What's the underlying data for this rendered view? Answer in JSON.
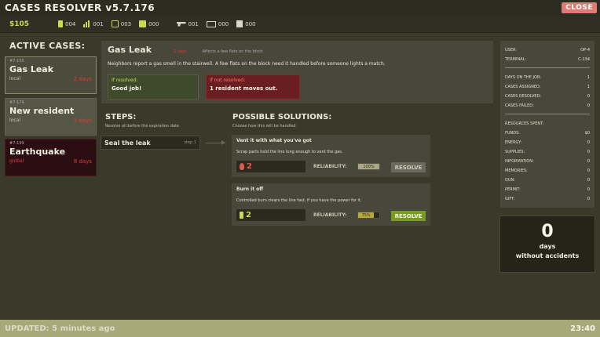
{
  "app": {
    "title": "CASES RESOLVER v5.7.176",
    "close_label": "CLOSE"
  },
  "resources_bar": {
    "money": "$105",
    "items": [
      {
        "icon": "energy-icon",
        "value": "004"
      },
      {
        "icon": "supplies-icon",
        "value": "001"
      },
      {
        "icon": "information-icon",
        "value": "003"
      },
      {
        "icon": "memories-icon",
        "value": "000"
      },
      {
        "icon": "gun-icon",
        "value": "001"
      },
      {
        "icon": "permit-icon",
        "value": "000"
      },
      {
        "icon": "gift-icon",
        "value": "000"
      }
    ]
  },
  "active_cases": {
    "title": "ACTIVE CASES:",
    "items": [
      {
        "id": "#7-155",
        "name": "Gas Leak",
        "scope": "local",
        "days": "2 days",
        "state": "active"
      },
      {
        "id": "#7-174",
        "name": "New resident",
        "scope": "local",
        "days": "3 days",
        "state": "normal"
      },
      {
        "id": "#7-199",
        "name": "Earthquake",
        "scope": "global",
        "days": "8 days",
        "state": "danger"
      }
    ]
  },
  "case_detail": {
    "title": "Gas Leak",
    "badge": "2 days",
    "affects": "Affects a few flats on the block",
    "description": "Neighbors report a gas smell in the stairwell. A few flats on the block need it handled before someone lights a match.",
    "if_resolved_label": "If resolved:",
    "if_resolved_text": "Good job!",
    "if_not_resolved_label": "If not resolved:",
    "if_not_resolved_text": "1 resident moves out."
  },
  "steps": {
    "title": "STEPS:",
    "subtitle": "Resolve all before the expiration date",
    "items": [
      {
        "label": "Seal the leak",
        "num": "step 1"
      }
    ]
  },
  "solutions": {
    "title": "POSSIBLE SOLUTIONS:",
    "subtitle": "Choose how this will be handled",
    "reliability_label": "RELIABILITY:",
    "resolve_label": "RESOLVE",
    "items": [
      {
        "name": "Vent it with what you've got",
        "desc": "Scrap parts hold the line long enough to vent the gas.",
        "cost_icon": "flame-icon",
        "cost": "2",
        "reliability": "100%",
        "reliability_value": 100,
        "enabled": false
      },
      {
        "name": "Burn it off",
        "desc": "Controlled burn clears the line fast, if you have the power for it.",
        "cost_icon": "battery-icon",
        "cost": "2",
        "reliability": "75%",
        "reliability_value": 75,
        "enabled": true
      }
    ]
  },
  "stats": {
    "user_label": "USER:",
    "user": "OP-4",
    "terminal_label": "TERMINAL:",
    "terminal": "C-134",
    "rows": [
      {
        "k": "DAYS ON THE JOB:",
        "v": "1"
      },
      {
        "k": "CASES ASSIGNED:",
        "v": "1"
      },
      {
        "k": "CASES RESOLVED:",
        "v": "0"
      },
      {
        "k": "CASES FAILED:",
        "v": "0"
      }
    ],
    "spent_title": "RESOURCES SPENT:",
    "spent": [
      {
        "k": "FUNDS:",
        "v": "$0"
      },
      {
        "k": "ENERGY:",
        "v": "0"
      },
      {
        "k": "SUPPLIES:",
        "v": "0"
      },
      {
        "k": "INFORMATION:",
        "v": "0"
      },
      {
        "k": "MEMORIES:",
        "v": "0"
      },
      {
        "k": "GUN:",
        "v": "0"
      },
      {
        "k": "PERMIT:",
        "v": "0"
      },
      {
        "k": "GIFT:",
        "v": "0"
      }
    ]
  },
  "accidents": {
    "count": "0",
    "label1": "days",
    "label2": "without accidents"
  },
  "footer": {
    "updated": "UPDATED: 5 minutes ago",
    "time": "23:40"
  },
  "colors": {
    "accent": "#c8dc52",
    "danger": "#e03c3c",
    "close": "#e07a74",
    "resolve": "#7a9a28"
  }
}
